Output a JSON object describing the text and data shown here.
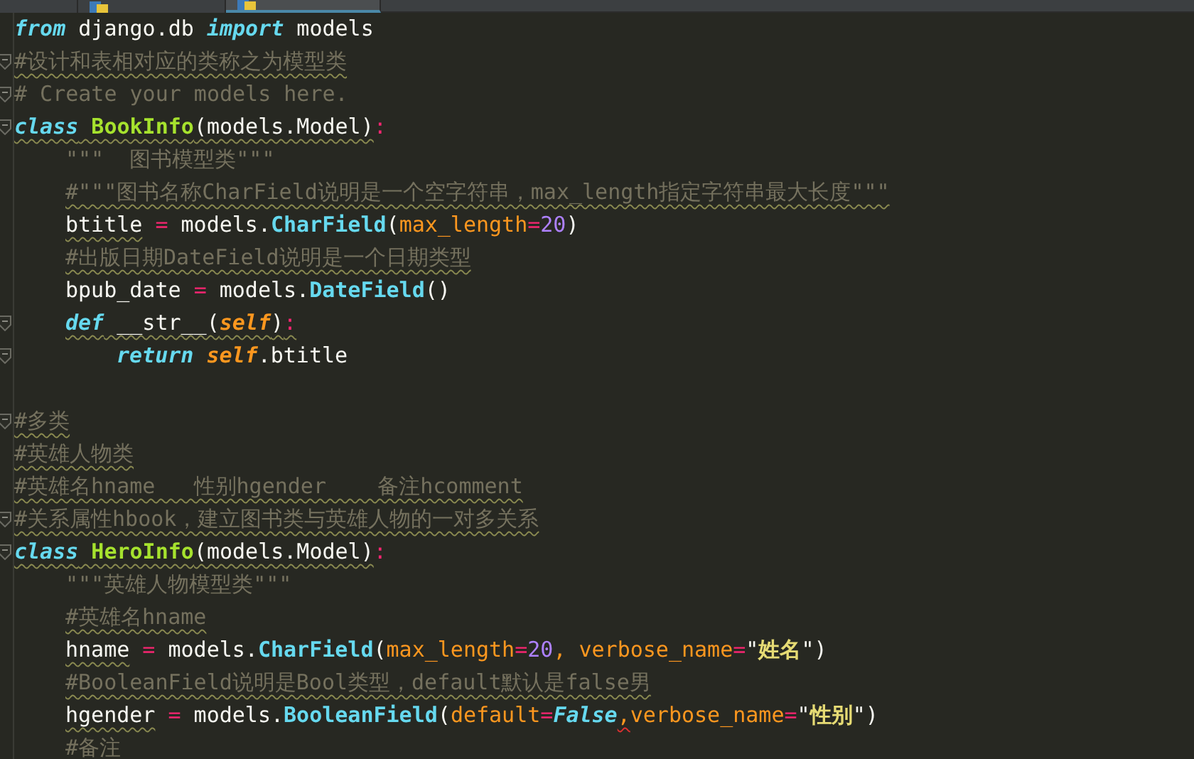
{
  "tabs": [
    {
      "selected": false,
      "has_icon": false
    },
    {
      "selected": false,
      "has_icon": true
    },
    {
      "selected": true,
      "has_icon": true
    }
  ],
  "lines": [
    {
      "kind": "code",
      "fold": false,
      "tokens": [
        {
          "kind": "keyword",
          "text": "from",
          "squiggle": false
        },
        {
          "kind": "plain",
          "text": " django.db ",
          "squiggle": false
        },
        {
          "kind": "keyword",
          "text": "import",
          "squiggle": false
        },
        {
          "kind": "plain",
          "text": " models",
          "squiggle": false
        }
      ]
    },
    {
      "kind": "code",
      "fold": true,
      "tokens": [
        {
          "kind": "comment",
          "text": "#设计和表相对应的类称之为模型类",
          "squiggle": true
        }
      ]
    },
    {
      "kind": "code",
      "fold": true,
      "tokens": [
        {
          "kind": "comment",
          "text": "# Create your models here.",
          "squiggle": false
        }
      ]
    },
    {
      "kind": "code",
      "fold": true,
      "tokens": [
        {
          "kind": "keyword",
          "text": "class",
          "squiggle": true
        },
        {
          "kind": "classname",
          "text": " BookInfo",
          "squiggle": true
        },
        {
          "kind": "plain",
          "text": "(models.Model)",
          "squiggle": true
        },
        {
          "kind": "operator",
          "text": ":",
          "squiggle": false
        }
      ],
      "children": [
        {
          "kind": "code",
          "fold": false,
          "tokens": [
            {
              "kind": "docstring",
              "text": "\"\"\"  图书模型类\"\"\"",
              "squiggle": false
            }
          ]
        },
        {
          "kind": "code",
          "fold": false,
          "tokens": [
            {
              "kind": "comment",
              "text": "#\"\"\"图书名称CharField说明是一个空字符串，max_length指定字符串最大长度\"\"\"",
              "squiggle": true
            }
          ]
        },
        {
          "kind": "code",
          "fold": false,
          "tokens": [
            {
              "kind": "plain",
              "text": "btitle",
              "squiggle": true
            },
            {
              "kind": "operator",
              "text": " =",
              "squiggle": false
            },
            {
              "kind": "plain",
              "text": " models.",
              "squiggle": false
            },
            {
              "kind": "call",
              "text": "CharField",
              "squiggle": false
            },
            {
              "kind": "plain",
              "text": "(",
              "squiggle": false
            },
            {
              "kind": "param",
              "text": "max_length",
              "squiggle": false
            },
            {
              "kind": "operator",
              "text": "=",
              "squiggle": false
            },
            {
              "kind": "number",
              "text": "20",
              "squiggle": false
            },
            {
              "kind": "plain",
              "text": ")",
              "squiggle": false
            }
          ]
        },
        {
          "kind": "code",
          "fold": false,
          "tokens": [
            {
              "kind": "comment",
              "text": "#出版日期DateField说明是一个日期类型",
              "squiggle": true
            }
          ]
        },
        {
          "kind": "code",
          "fold": false,
          "tokens": [
            {
              "kind": "plain",
              "text": "bpub_date ",
              "squiggle": false
            },
            {
              "kind": "operator",
              "text": "=",
              "squiggle": false
            },
            {
              "kind": "plain",
              "text": " models.",
              "squiggle": false
            },
            {
              "kind": "call",
              "text": "DateField",
              "squiggle": false
            },
            {
              "kind": "plain",
              "text": "()",
              "squiggle": false
            }
          ]
        },
        {
          "kind": "code",
          "fold": true,
          "tokens": [
            {
              "kind": "keyword",
              "text": "def",
              "squiggle": true
            },
            {
              "kind": "plain",
              "text": " __str__(",
              "squiggle": true
            },
            {
              "kind": "self",
              "text": "self",
              "squiggle": true
            },
            {
              "kind": "plain",
              "text": ")",
              "squiggle": true
            },
            {
              "kind": "operator",
              "text": ":",
              "squiggle": true
            }
          ],
          "children": [
            {
              "kind": "code",
              "fold": true,
              "tokens": [
                {
                  "kind": "keyword",
                  "text": "return",
                  "squiggle": false
                },
                {
                  "kind": "self",
                  "text": " self",
                  "squiggle": false
                },
                {
                  "kind": "plain",
                  "text": ".btitle",
                  "squiggle": false
                }
              ]
            }
          ]
        }
      ]
    },
    {
      "kind": "blank",
      "fold": false
    },
    {
      "kind": "code",
      "fold": true,
      "tokens": [
        {
          "kind": "comment",
          "text": "#多类",
          "squiggle": true
        }
      ]
    },
    {
      "kind": "code",
      "fold": false,
      "tokens": [
        {
          "kind": "comment",
          "text": "#英雄人物类",
          "squiggle": true
        }
      ]
    },
    {
      "kind": "code",
      "fold": false,
      "tokens": [
        {
          "kind": "comment",
          "text": "#英雄名hname   性别hgender    备注hcomment",
          "squiggle": true
        }
      ]
    },
    {
      "kind": "code",
      "fold": true,
      "tokens": [
        {
          "kind": "comment",
          "text": "#关系属性hbook，建立图书类与英雄人物的一对多关系",
          "squiggle": true
        }
      ]
    },
    {
      "kind": "code",
      "fold": true,
      "tokens": [
        {
          "kind": "keyword",
          "text": "class",
          "squiggle": true
        },
        {
          "kind": "classname",
          "text": " HeroInfo",
          "squiggle": true
        },
        {
          "kind": "plain",
          "text": "(models.Model)",
          "squiggle": true
        },
        {
          "kind": "operator",
          "text": ":",
          "squiggle": false
        }
      ],
      "children": [
        {
          "kind": "code",
          "fold": false,
          "tokens": [
            {
              "kind": "docstring",
              "text": "\"\"\"英雄人物模型类\"\"\"",
              "squiggle": false
            }
          ]
        },
        {
          "kind": "code",
          "fold": false,
          "tokens": [
            {
              "kind": "comment",
              "text": "#英雄名hname",
              "squiggle": true
            }
          ]
        },
        {
          "kind": "code",
          "fold": false,
          "tokens": [
            {
              "kind": "plain",
              "text": "hname",
              "squiggle": true
            },
            {
              "kind": "operator",
              "text": " =",
              "squiggle": false
            },
            {
              "kind": "plain",
              "text": " models.",
              "squiggle": false
            },
            {
              "kind": "call",
              "text": "CharField",
              "squiggle": false
            },
            {
              "kind": "plain",
              "text": "(",
              "squiggle": false
            },
            {
              "kind": "param",
              "text": "max_length",
              "squiggle": false
            },
            {
              "kind": "operator",
              "text": "=",
              "squiggle": false
            },
            {
              "kind": "number",
              "text": "20",
              "squiggle": false
            },
            {
              "kind": "param",
              "text": ", verbose_name",
              "squiggle": false
            },
            {
              "kind": "operator",
              "text": "=",
              "squiggle": false
            },
            {
              "kind": "plain",
              "text": "\"",
              "squiggle": false
            },
            {
              "kind": "string",
              "text": "姓名",
              "squiggle": false
            },
            {
              "kind": "plain",
              "text": "\")",
              "squiggle": false
            }
          ]
        },
        {
          "kind": "code",
          "fold": false,
          "tokens": [
            {
              "kind": "comment",
              "text": "#BooleanField说明是Bool类型，default默认是false男",
              "squiggle": true
            }
          ]
        },
        {
          "kind": "code",
          "fold": false,
          "tokens": [
            {
              "kind": "plain",
              "text": "hgender",
              "squiggle": true
            },
            {
              "kind": "operator",
              "text": " =",
              "squiggle": false
            },
            {
              "kind": "plain",
              "text": " models.",
              "squiggle": false
            },
            {
              "kind": "call",
              "text": "BooleanField",
              "squiggle": false
            },
            {
              "kind": "plain",
              "text": "(",
              "squiggle": false
            },
            {
              "kind": "param",
              "text": "default",
              "squiggle": false
            },
            {
              "kind": "operator",
              "text": "=",
              "squiggle": false
            },
            {
              "kind": "constant",
              "text": "False",
              "squiggle": false
            },
            {
              "kind": "param",
              "text": ",",
              "squiggle": true
            },
            {
              "kind": "param",
              "text": "verbose_name",
              "squiggle": false
            },
            {
              "kind": "operator",
              "text": "=",
              "squiggle": false
            },
            {
              "kind": "plain",
              "text": "\"",
              "squiggle": false
            },
            {
              "kind": "string",
              "text": "性别",
              "squiggle": false
            },
            {
              "kind": "plain",
              "text": "\")",
              "squiggle": false
            }
          ]
        },
        {
          "kind": "code",
          "fold": false,
          "tokens": [
            {
              "kind": "comment",
              "text": "#备注"
            }
          ]
        }
      ]
    }
  ]
}
